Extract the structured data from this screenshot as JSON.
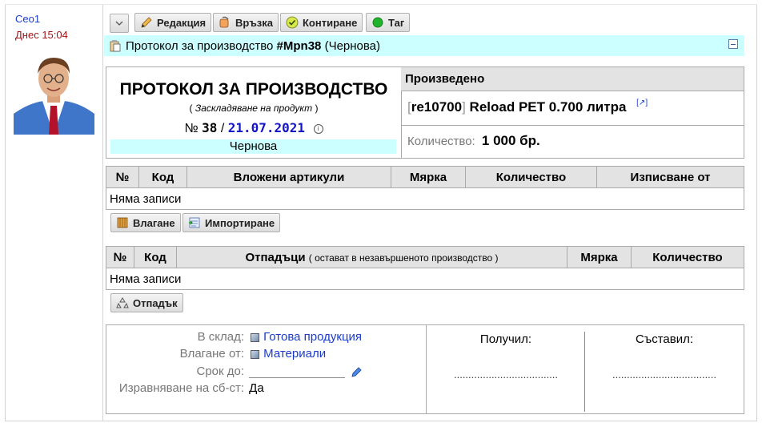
{
  "author": {
    "name": "Ceo1",
    "time": "Днес 15:04"
  },
  "toolbar": {
    "menu_icon": "chevron-down-icon",
    "edit_label": "Редакция",
    "link_label": "Връзка",
    "post_label": "Контиране",
    "tag_label": "Таг"
  },
  "doc_bar": {
    "prefix": "Протокол за производство",
    "handle": "#Mpn38",
    "state": "(Чернова)"
  },
  "header": {
    "title": "ПРОТОКОЛ ЗА ПРОИЗВОДСТВО",
    "subtitle_open": "( ",
    "subtitle": "Заскладяване на продукт",
    "subtitle_close": " )",
    "number_prefix": "№",
    "number": "38",
    "separator": "/",
    "date": "21.07.2021",
    "state": "Чернова"
  },
  "produced": {
    "title": "Произведено",
    "code_open": "[",
    "code": "re10700",
    "code_close": "]",
    "name": "Reload PET 0.700 литра",
    "ext_link": "[↗]",
    "qty_label": "Количество:",
    "qty_value": "1 000 бр."
  },
  "inputs_table": {
    "headers": [
      "№",
      "Код",
      "Вложени артикули",
      "Мярка",
      "Количество",
      "Изписване от"
    ],
    "empty": "Няма записи",
    "add_label": "Влагане",
    "import_label": "Импортиране"
  },
  "waste_table": {
    "headers": [
      "№",
      "Код",
      "Отпадъци",
      "Мярка",
      "Количество"
    ],
    "waste_note": "( остават в незавършеното производство )",
    "empty": "Няма записи",
    "add_label": "Отпадък"
  },
  "footer": {
    "store_label": "В склад:",
    "store_value": "Готова продукция",
    "input_from_label": "Влагане от:",
    "input_from_value": "Материали",
    "deadline_label": "Срок до:",
    "equalize_label": "Изравняване на сб-ст:",
    "equalize_value": "Да",
    "received_label": "Получил:",
    "composed_label": "Съставил:",
    "signature_dots": "...................................."
  },
  "colors": {
    "accent_cyan": "#ccffff",
    "link_blue": "#1a3ccc",
    "date_red": "#a31414"
  }
}
